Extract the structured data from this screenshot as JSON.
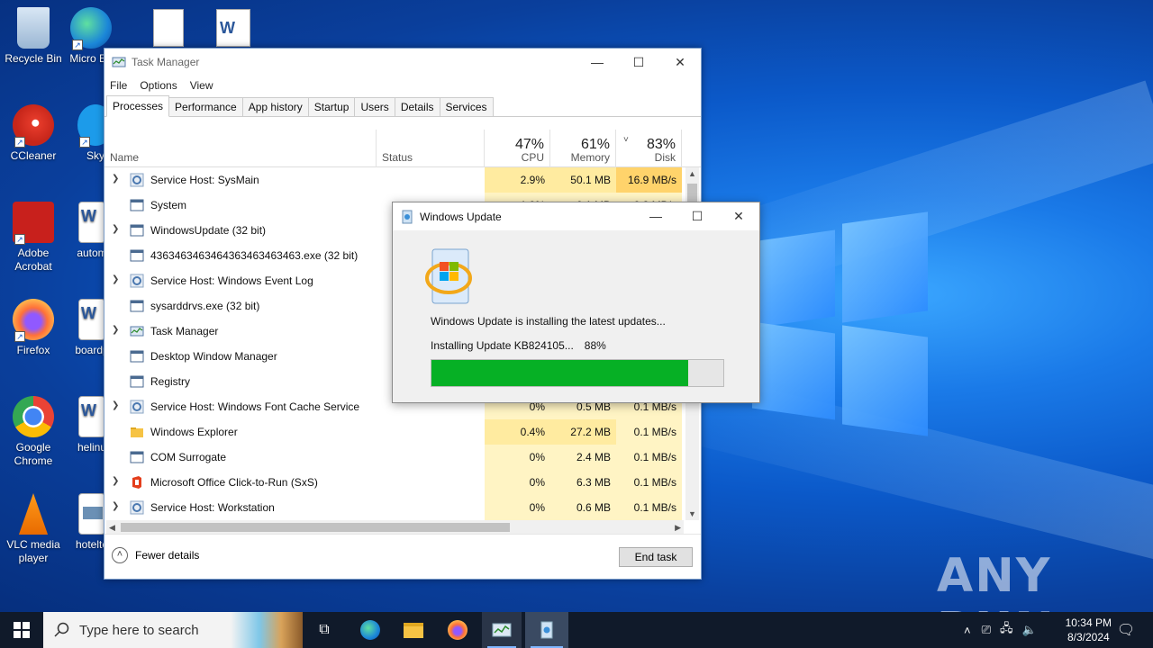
{
  "desktop": {
    "icons": [
      {
        "label": "Recycle Bin",
        "icon": "recycle-bin-icon"
      },
      {
        "label": "Micro Ed",
        "icon": "edge-icon"
      },
      {
        "label": "CCleaner",
        "icon": "ccleaner-icon"
      },
      {
        "label": "Sky",
        "icon": "skype-icon"
      },
      {
        "label": "Adobe Acrobat",
        "icon": "acrobat-icon"
      },
      {
        "label": "autom",
        "icon": "word-doc-icon"
      },
      {
        "label": "Firefox",
        "icon": "firefox-icon"
      },
      {
        "label": "boardp",
        "icon": "word-doc-icon"
      },
      {
        "label": "Google Chrome",
        "icon": "chrome-icon"
      },
      {
        "label": "helinu",
        "icon": "word-doc-icon"
      },
      {
        "label": "VLC media player",
        "icon": "vlc-icon"
      },
      {
        "label": "hotelte",
        "icon": "image-file-icon"
      }
    ],
    "watermark": "ANY RUN"
  },
  "taskmgr": {
    "title": "Task Manager",
    "menu": [
      "File",
      "Options",
      "View"
    ],
    "tabs": [
      "Processes",
      "Performance",
      "App history",
      "Startup",
      "Users",
      "Details",
      "Services"
    ],
    "active_tab": "Processes",
    "columns": {
      "name": "Name",
      "status": "Status",
      "cpu": {
        "pct": "47%",
        "label": "CPU"
      },
      "memory": {
        "pct": "61%",
        "label": "Memory"
      },
      "disk": {
        "pct": "83%",
        "label": "Disk"
      }
    },
    "rows": [
      {
        "name": "Service Host: SysMain",
        "expand": true,
        "icon": "gear-service-icon",
        "cpu": "2.9%",
        "mem": "50.1 MB",
        "disk": "16.9 MB/s"
      },
      {
        "name": "System",
        "expand": false,
        "icon": "process-window-icon",
        "cpu": "1.9%",
        "mem": "0.1 MB",
        "disk": "0.3 MB/s"
      },
      {
        "name": "WindowsUpdate (32 bit)",
        "expand": true,
        "icon": "process-window-icon",
        "cpu": "",
        "mem": "",
        "disk": ""
      },
      {
        "name": "4363463463464363463463463.exe (32 bit)",
        "expand": false,
        "icon": "process-window-icon",
        "cpu": "",
        "mem": "",
        "disk": ""
      },
      {
        "name": "Service Host: Windows Event Log",
        "expand": true,
        "icon": "gear-service-icon",
        "cpu": "",
        "mem": "",
        "disk": ""
      },
      {
        "name": "sysarddrvs.exe (32 bit)",
        "expand": false,
        "icon": "process-window-icon",
        "cpu": "",
        "mem": "",
        "disk": ""
      },
      {
        "name": "Task Manager",
        "expand": true,
        "icon": "task-manager-icon",
        "cpu": "",
        "mem": "",
        "disk": ""
      },
      {
        "name": "Desktop Window Manager",
        "expand": false,
        "icon": "process-window-icon",
        "cpu": "",
        "mem": "",
        "disk": ""
      },
      {
        "name": "Registry",
        "expand": false,
        "icon": "process-window-icon",
        "cpu": "",
        "mem": "",
        "disk": ""
      },
      {
        "name": "Service Host: Windows Font Cache Service",
        "expand": true,
        "icon": "gear-service-icon",
        "cpu": "0%",
        "mem": "0.5 MB",
        "disk": "0.1 MB/s"
      },
      {
        "name": "Windows Explorer",
        "expand": false,
        "icon": "folder-icon",
        "cpu": "0.4%",
        "mem": "27.2 MB",
        "disk": "0.1 MB/s"
      },
      {
        "name": "COM Surrogate",
        "expand": false,
        "icon": "process-window-icon",
        "cpu": "0%",
        "mem": "2.4 MB",
        "disk": "0.1 MB/s"
      },
      {
        "name": "Microsoft Office Click-to-Run (SxS)",
        "expand": true,
        "icon": "office-icon",
        "cpu": "0%",
        "mem": "6.3 MB",
        "disk": "0.1 MB/s"
      },
      {
        "name": "Service Host: Workstation",
        "expand": true,
        "icon": "gear-service-icon",
        "cpu": "0%",
        "mem": "0.6 MB",
        "disk": "0.1 MB/s"
      }
    ],
    "fewer_details": "Fewer details",
    "end_task": "End task"
  },
  "wu": {
    "title": "Windows Update",
    "message": "Windows Update is installing the latest updates...",
    "status": "Installing Update KB824105...",
    "percent_text": "88%",
    "progress": 0.88
  },
  "taskbar": {
    "search_placeholder": "Type here to search",
    "time": "10:34 PM",
    "date": "8/3/2024"
  }
}
